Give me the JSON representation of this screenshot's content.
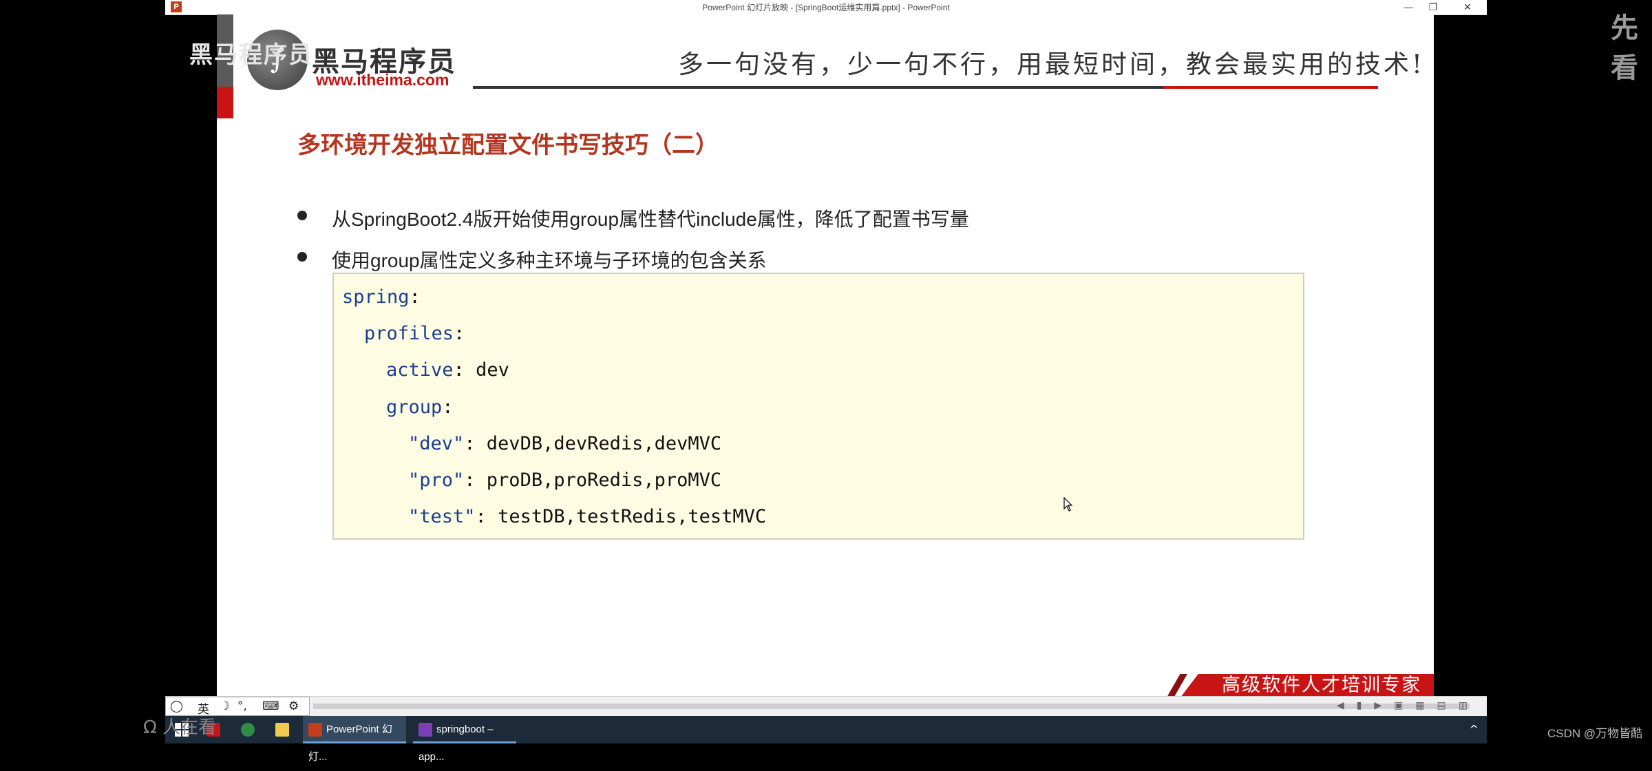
{
  "window": {
    "title": "PowerPoint 幻灯片放映 - [SpringBoot运维实用篇.pptx] - PowerPoint",
    "minimize": "—",
    "restore": "❐",
    "close": "✕"
  },
  "overlay": {
    "watermark_left": "黑马程序员",
    "watermark_right": "先看",
    "bottom_left": "Ω 人在看",
    "csdn": "CSDN @万物皆酷"
  },
  "slide": {
    "logo_name": "黑马程序员",
    "logo_url": "www.itheima.com",
    "slogan": "多一句没有，少一句不行，用最短时间，教会最实用的技术!",
    "heading": "多环境开发独立配置文件书写技巧（二）",
    "bullets": [
      "从SpringBoot2.4版开始使用group属性替代include属性，降低了配置书写量",
      "使用group属性定义多种主环境与子环境的包含关系"
    ],
    "code": {
      "l1_key": "spring",
      "l2_key": "profiles",
      "l3_key": "active",
      "l3_val": "dev",
      "l4_key": "group",
      "l5_key": "\"dev\"",
      "l5_val": "devDB,devRedis,devMVC",
      "l6_key": "\"pro\"",
      "l6_val": "proDB,proRedis,proMVC",
      "l7_key": "\"test\"",
      "l7_val": "testDB,testRedis,testMVC"
    },
    "banner": "高级软件人才培训专家"
  },
  "ime": {
    "lang": "英",
    "moon": "☽",
    "punct": "°,",
    "keyboard": "⌨",
    "settings": "⚙"
  },
  "taskbar": {
    "items": [
      {
        "label": "PowerPoint 幻灯..."
      },
      {
        "label": "springboot – app..."
      }
    ],
    "tray": "^"
  },
  "colors": {
    "brand_red": "#c81414",
    "heading": "#b5351f",
    "code_bg": "#fefde3",
    "code_keyword": "#1a3f91"
  }
}
